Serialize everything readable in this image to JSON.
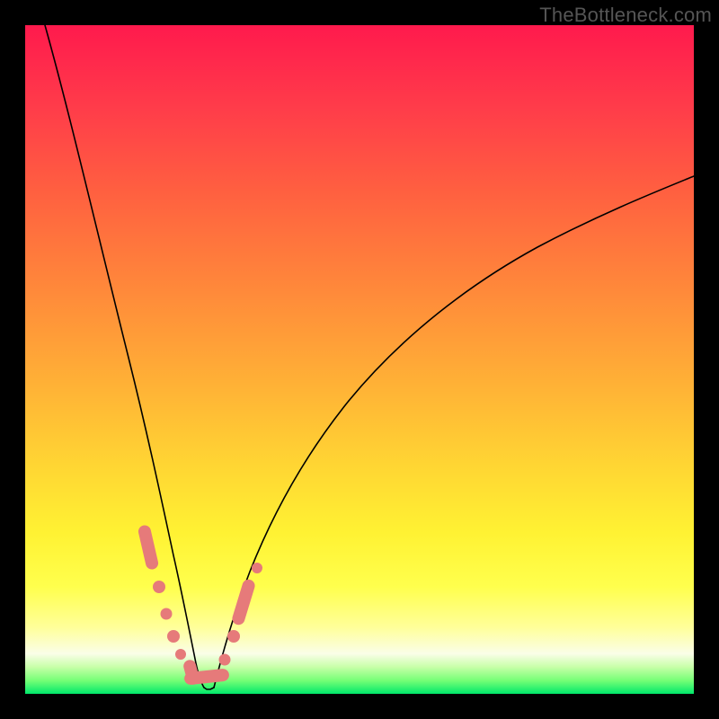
{
  "watermark": "TheBottleneck.com",
  "colors": {
    "background": "#000000",
    "curve": "#000000",
    "marker": "#e67a7a",
    "watermark": "#555555"
  },
  "chart_data": {
    "type": "line",
    "title": "",
    "xlabel": "",
    "ylabel": "",
    "xlim": [
      0,
      100
    ],
    "ylim": [
      0,
      100
    ],
    "grid": false,
    "legend": false,
    "series": [
      {
        "name": "left-curve",
        "type": "line",
        "x": [
          3.0,
          4.8,
          6.8,
          8.8,
          10.8,
          12.6,
          14.4,
          16.2,
          17.8,
          19.2,
          20.2,
          21.2,
          22.0,
          23.1,
          24.5,
          26.1
        ],
        "y": [
          100,
          90.3,
          79.6,
          69.0,
          58.3,
          48.9,
          39.8,
          31.2,
          24.2,
          18.3,
          14.5,
          11.3,
          8.3,
          5.2,
          2.4,
          0.9
        ]
      },
      {
        "name": "right-curve",
        "type": "line",
        "x": [
          27.0,
          28.5,
          30.1,
          32.3,
          35.2,
          38.6,
          42.7,
          47.7,
          53.6,
          61.0,
          69.4,
          77.6,
          86.0,
          93.0,
          100.0
        ],
        "y": [
          0.9,
          2.7,
          5.9,
          10.2,
          15.6,
          21.5,
          28.0,
          34.9,
          42.1,
          49.9,
          57.4,
          63.9,
          69.6,
          73.8,
          77.4
        ]
      },
      {
        "name": "markers",
        "type": "scatter",
        "x": [
          18.2,
          19.0,
          19.8,
          20.8,
          21.8,
          22.6,
          23.8,
          24.8,
          26.1,
          27.0,
          28.4,
          29.6,
          30.9,
          32.4,
          33.8
        ],
        "y": [
          22.6,
          19.6,
          16.7,
          13.0,
          9.7,
          7.0,
          4.3,
          2.4,
          0.9,
          0.9,
          2.4,
          5.1,
          8.1,
          10.8,
          13.2
        ]
      }
    ],
    "annotations": [
      {
        "text": "TheBottleneck.com",
        "role": "watermark",
        "position": "top-right"
      }
    ]
  }
}
